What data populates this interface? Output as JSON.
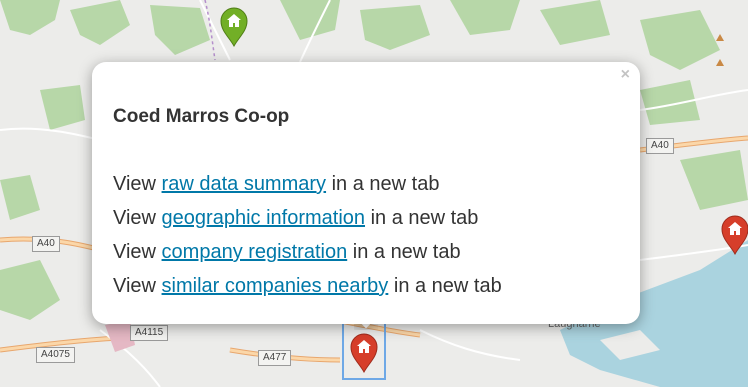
{
  "map": {
    "road_labels": [
      "A40",
      "A40",
      "A4115",
      "A4075",
      "A477"
    ],
    "place_labels": [
      "Laugharne"
    ],
    "colors": {
      "background": "#ececea",
      "woodland": "#aed1a0",
      "water": "#aad3df",
      "road_major": "#f6c79b",
      "road_minor": "#ffffff",
      "marker_red": "#d63e2a",
      "marker_green": "#72af26"
    },
    "markers": [
      {
        "name": "green-home-marker",
        "color": "green",
        "icon": "home-icon"
      },
      {
        "name": "red-home-marker-selected",
        "color": "red",
        "icon": "home-icon"
      },
      {
        "name": "red-home-marker-east",
        "color": "red",
        "icon": "home-icon"
      }
    ]
  },
  "popup": {
    "close_label": "×",
    "title": "Coed Marros Co-op",
    "lines": [
      {
        "prefix": "View ",
        "link": "raw data summary",
        "suffix": " in a new tab"
      },
      {
        "prefix": "View ",
        "link": "geographic information",
        "suffix": " in a new tab"
      },
      {
        "prefix": "View ",
        "link": "company registration",
        "suffix": " in a new tab"
      },
      {
        "prefix": "View ",
        "link": "similar companies nearby",
        "suffix": " in a new tab"
      }
    ]
  }
}
